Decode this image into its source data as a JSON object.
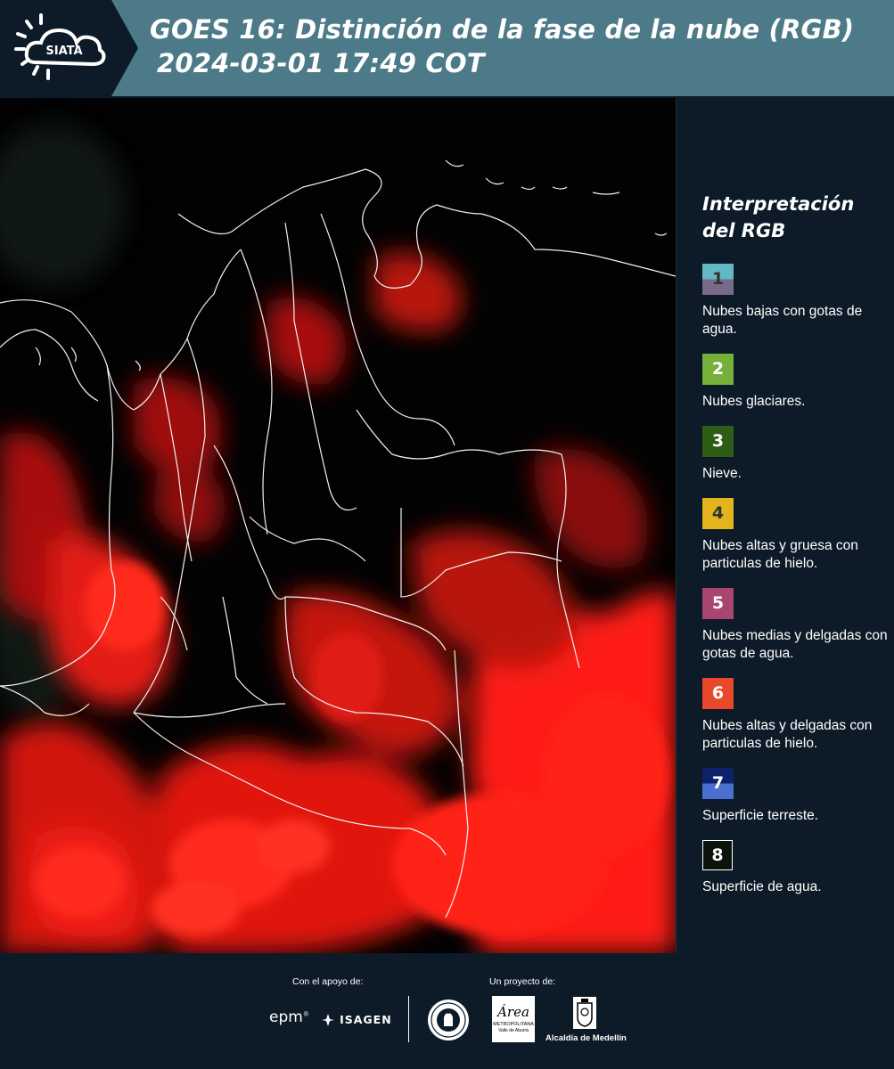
{
  "header": {
    "logo_text": "SIATA",
    "title_line1": "GOES 16: Distinción de la fase de la nube (RGB)",
    "title_line2": "2024-03-01 17:49 COT",
    "bg_color": "#4d7a88"
  },
  "legend": {
    "title_line1": "Interpretación",
    "title_line2": "del RGB",
    "items": [
      {
        "number": "1",
        "description": "Nubes bajas con gotas de agua.",
        "color_top": "#63b8c6",
        "color_bottom": "#7a6a8a",
        "text_color": "#333333"
      },
      {
        "number": "2",
        "description": "Nubes glaciares.",
        "color_top": "#74b03a",
        "color_bottom": "#74b03a",
        "text_color": "#ffffff"
      },
      {
        "number": "3",
        "description": "Nieve.",
        "color_top": "#2e5e16",
        "color_bottom": "#2e5e16",
        "text_color": "#ffffff"
      },
      {
        "number": "4",
        "description": "Nubes altas y gruesa con particulas de hielo.",
        "color_top": "#e3b41e",
        "color_bottom": "#e3b41e",
        "text_color": "#333333"
      },
      {
        "number": "5",
        "description": "Nubes medias y delgadas con gotas de agua.",
        "color_top": "#a8466f",
        "color_bottom": "#a8466f",
        "text_color": "#ffffff"
      },
      {
        "number": "6",
        "description": "Nubes altas y delgadas con particulas de hielo.",
        "color_top": "#e8492a",
        "color_bottom": "#e8492a",
        "text_color": "#ffffff"
      },
      {
        "number": "7",
        "description": "Superficie terreste.",
        "color_top": "#0d2268",
        "color_bottom": "#4a6fd0",
        "text_color": "#ffffff"
      },
      {
        "number": "8",
        "description": "Superficie de agua.",
        "color_top": "#0a140a",
        "color_bottom": "#0a140a",
        "text_color": "#ffffff"
      }
    ]
  },
  "footer": {
    "support_label": "Con el apoyo de:",
    "project_label": "Un proyecto de:",
    "sponsor1": "epm",
    "sponsor2": "ISAGEN",
    "partner1_line1": "Área",
    "partner1_line2": "METROPOLITANA",
    "partner1_line3": "Valle de Aburrá",
    "partner2": "Alcaldía de Medellín"
  }
}
